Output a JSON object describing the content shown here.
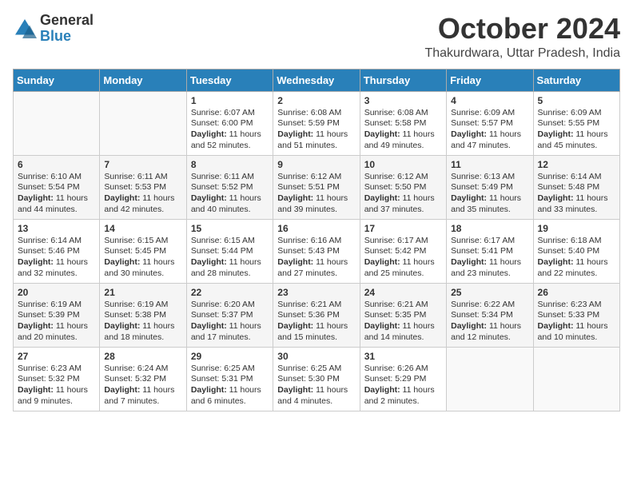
{
  "header": {
    "logo_general": "General",
    "logo_blue": "Blue",
    "month_year": "October 2024",
    "location": "Thakurdwara, Uttar Pradesh, India"
  },
  "weekdays": [
    "Sunday",
    "Monday",
    "Tuesday",
    "Wednesday",
    "Thursday",
    "Friday",
    "Saturday"
  ],
  "weeks": [
    {
      "days": [
        {
          "date": "",
          "content": ""
        },
        {
          "date": "",
          "content": ""
        },
        {
          "date": "1",
          "content": "Sunrise: 6:07 AM\nSunset: 6:00 PM\nDaylight: 11 hours and 52 minutes."
        },
        {
          "date": "2",
          "content": "Sunrise: 6:08 AM\nSunset: 5:59 PM\nDaylight: 11 hours and 51 minutes."
        },
        {
          "date": "3",
          "content": "Sunrise: 6:08 AM\nSunset: 5:58 PM\nDaylight: 11 hours and 49 minutes."
        },
        {
          "date": "4",
          "content": "Sunrise: 6:09 AM\nSunset: 5:57 PM\nDaylight: 11 hours and 47 minutes."
        },
        {
          "date": "5",
          "content": "Sunrise: 6:09 AM\nSunset: 5:55 PM\nDaylight: 11 hours and 45 minutes."
        }
      ]
    },
    {
      "days": [
        {
          "date": "6",
          "content": "Sunrise: 6:10 AM\nSunset: 5:54 PM\nDaylight: 11 hours and 44 minutes."
        },
        {
          "date": "7",
          "content": "Sunrise: 6:11 AM\nSunset: 5:53 PM\nDaylight: 11 hours and 42 minutes."
        },
        {
          "date": "8",
          "content": "Sunrise: 6:11 AM\nSunset: 5:52 PM\nDaylight: 11 hours and 40 minutes."
        },
        {
          "date": "9",
          "content": "Sunrise: 6:12 AM\nSunset: 5:51 PM\nDaylight: 11 hours and 39 minutes."
        },
        {
          "date": "10",
          "content": "Sunrise: 6:12 AM\nSunset: 5:50 PM\nDaylight: 11 hours and 37 minutes."
        },
        {
          "date": "11",
          "content": "Sunrise: 6:13 AM\nSunset: 5:49 PM\nDaylight: 11 hours and 35 minutes."
        },
        {
          "date": "12",
          "content": "Sunrise: 6:14 AM\nSunset: 5:48 PM\nDaylight: 11 hours and 33 minutes."
        }
      ]
    },
    {
      "days": [
        {
          "date": "13",
          "content": "Sunrise: 6:14 AM\nSunset: 5:46 PM\nDaylight: 11 hours and 32 minutes."
        },
        {
          "date": "14",
          "content": "Sunrise: 6:15 AM\nSunset: 5:45 PM\nDaylight: 11 hours and 30 minutes."
        },
        {
          "date": "15",
          "content": "Sunrise: 6:15 AM\nSunset: 5:44 PM\nDaylight: 11 hours and 28 minutes."
        },
        {
          "date": "16",
          "content": "Sunrise: 6:16 AM\nSunset: 5:43 PM\nDaylight: 11 hours and 27 minutes."
        },
        {
          "date": "17",
          "content": "Sunrise: 6:17 AM\nSunset: 5:42 PM\nDaylight: 11 hours and 25 minutes."
        },
        {
          "date": "18",
          "content": "Sunrise: 6:17 AM\nSunset: 5:41 PM\nDaylight: 11 hours and 23 minutes."
        },
        {
          "date": "19",
          "content": "Sunrise: 6:18 AM\nSunset: 5:40 PM\nDaylight: 11 hours and 22 minutes."
        }
      ]
    },
    {
      "days": [
        {
          "date": "20",
          "content": "Sunrise: 6:19 AM\nSunset: 5:39 PM\nDaylight: 11 hours and 20 minutes."
        },
        {
          "date": "21",
          "content": "Sunrise: 6:19 AM\nSunset: 5:38 PM\nDaylight: 11 hours and 18 minutes."
        },
        {
          "date": "22",
          "content": "Sunrise: 6:20 AM\nSunset: 5:37 PM\nDaylight: 11 hours and 17 minutes."
        },
        {
          "date": "23",
          "content": "Sunrise: 6:21 AM\nSunset: 5:36 PM\nDaylight: 11 hours and 15 minutes."
        },
        {
          "date": "24",
          "content": "Sunrise: 6:21 AM\nSunset: 5:35 PM\nDaylight: 11 hours and 14 minutes."
        },
        {
          "date": "25",
          "content": "Sunrise: 6:22 AM\nSunset: 5:34 PM\nDaylight: 11 hours and 12 minutes."
        },
        {
          "date": "26",
          "content": "Sunrise: 6:23 AM\nSunset: 5:33 PM\nDaylight: 11 hours and 10 minutes."
        }
      ]
    },
    {
      "days": [
        {
          "date": "27",
          "content": "Sunrise: 6:23 AM\nSunset: 5:32 PM\nDaylight: 11 hours and 9 minutes."
        },
        {
          "date": "28",
          "content": "Sunrise: 6:24 AM\nSunset: 5:32 PM\nDaylight: 11 hours and 7 minutes."
        },
        {
          "date": "29",
          "content": "Sunrise: 6:25 AM\nSunset: 5:31 PM\nDaylight: 11 hours and 6 minutes."
        },
        {
          "date": "30",
          "content": "Sunrise: 6:25 AM\nSunset: 5:30 PM\nDaylight: 11 hours and 4 minutes."
        },
        {
          "date": "31",
          "content": "Sunrise: 6:26 AM\nSunset: 5:29 PM\nDaylight: 11 hours and 2 minutes."
        },
        {
          "date": "",
          "content": ""
        },
        {
          "date": "",
          "content": ""
        }
      ]
    }
  ]
}
